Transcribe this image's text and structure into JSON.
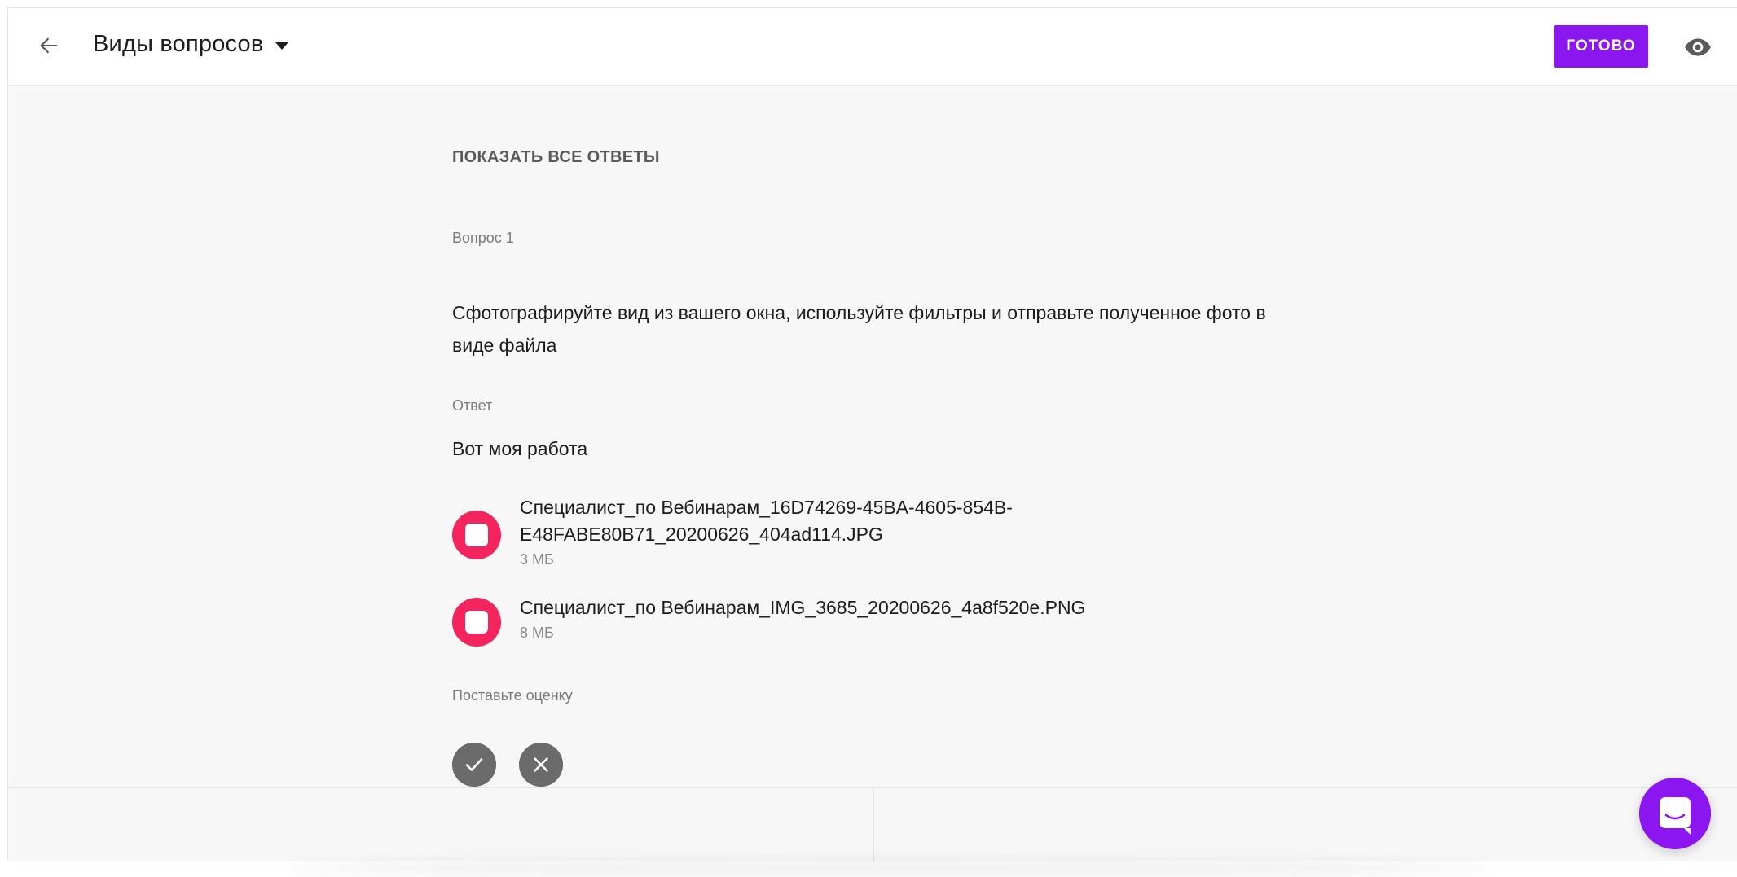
{
  "header": {
    "title": "Виды вопросов",
    "done_label": "ГОТОВО"
  },
  "main": {
    "show_all_label": "ПОКАЗАТЬ ВСЕ ОТВЕТЫ",
    "question_label": "Вопрос 1",
    "question_text": "Сфотографируйте вид из вашего окна, используйте фильтры и отправьте полученное фото в виде файла",
    "answer_label": "Ответ",
    "answer_text": "Вот моя работа",
    "files": [
      {
        "name": "Специалист_по Вебинарам_16D74269-45BA-4605-854B-E48FABE80B71_20200626_404ad114.JPG",
        "size": "3 МБ"
      },
      {
        "name": "Специалист_по Вебинарам_IMG_3685_20200626_4a8f520e.PNG",
        "size": "8 МБ"
      }
    ],
    "grade_label": "Поставьте оценку"
  },
  "icons": {
    "back": "arrow-left",
    "dropdown": "caret-down",
    "preview": "eye",
    "file": "file",
    "approve": "check",
    "reject": "close",
    "chat": "chat"
  },
  "colors": {
    "accent": "#8b16f0",
    "file_icon": "#f4245e",
    "grade_button": "#6b6b6b",
    "background": "#f7f7f7"
  }
}
